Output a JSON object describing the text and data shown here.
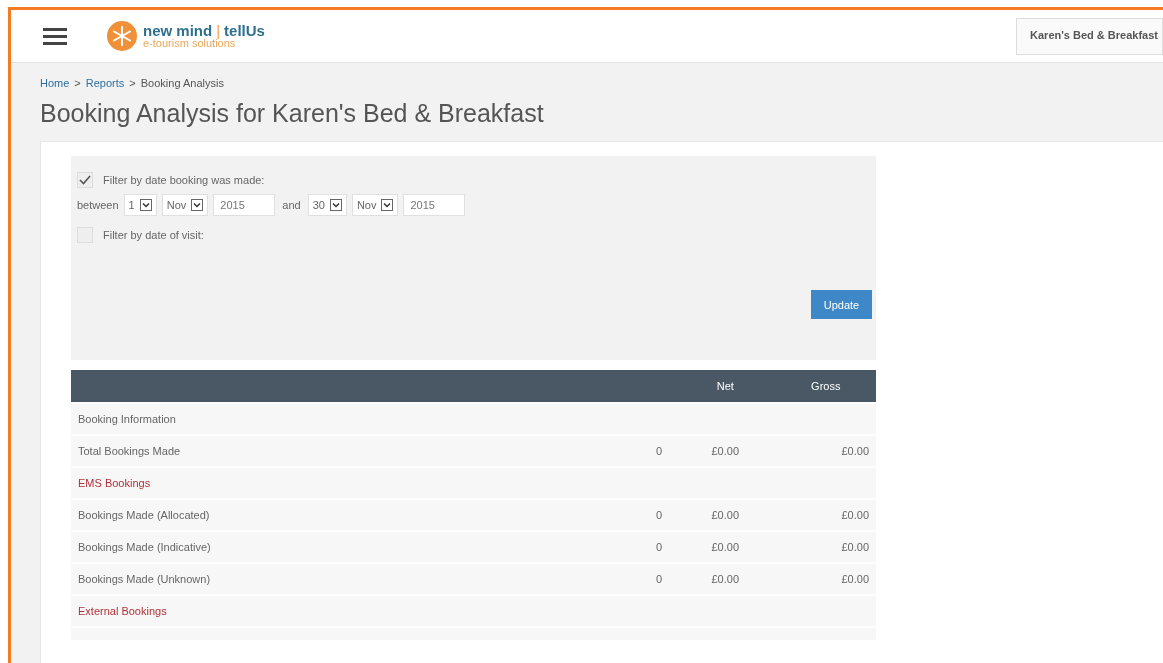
{
  "header": {
    "logo": {
      "name": "new mind",
      "separator": "|",
      "product": "tellUs",
      "tagline": "e-tourism solutions"
    },
    "account": "Karen's Bed & Breakfast"
  },
  "breadcrumb": [
    {
      "label": "Home",
      "link": true
    },
    {
      "label": ">",
      "link": false
    },
    {
      "label": "Reports",
      "link": true
    },
    {
      "label": ">",
      "link": false
    },
    {
      "label": "Booking Analysis",
      "link": false
    }
  ],
  "page_title": "Booking Analysis for Karen's Bed & Breakfast",
  "filters": [
    {
      "label": "Filter by date booking was made:",
      "checked": true,
      "range": {
        "prefix": "between",
        "from": {
          "day": "1",
          "month": "Nov",
          "year": "2015"
        },
        "joiner": "and",
        "to": {
          "day": "30",
          "month": "Nov",
          "year": "2015"
        }
      }
    },
    {
      "label": "Filter by date of visit:",
      "checked": false
    }
  ],
  "update_button": "Update",
  "table": {
    "columns": [
      "Net",
      "Gross"
    ],
    "rows": [
      {
        "kind": "heading",
        "label": "Booking Information"
      },
      {
        "kind": "data",
        "label": "Total Bookings Made",
        "count": "0",
        "net": "£0.00",
        "gross": "£0.00"
      },
      {
        "kind": "group",
        "label": "EMS Bookings"
      },
      {
        "kind": "data",
        "label": "Bookings Made (Allocated)",
        "count": "0",
        "net": "£0.00",
        "gross": "£0.00"
      },
      {
        "kind": "data",
        "label": "Bookings Made (Indicative)",
        "count": "0",
        "net": "£0.00",
        "gross": "£0.00"
      },
      {
        "kind": "data",
        "label": "Bookings Made (Unknown)",
        "count": "0",
        "net": "£0.00",
        "gross": "£0.00"
      },
      {
        "kind": "group",
        "label": "External Bookings"
      }
    ]
  }
}
